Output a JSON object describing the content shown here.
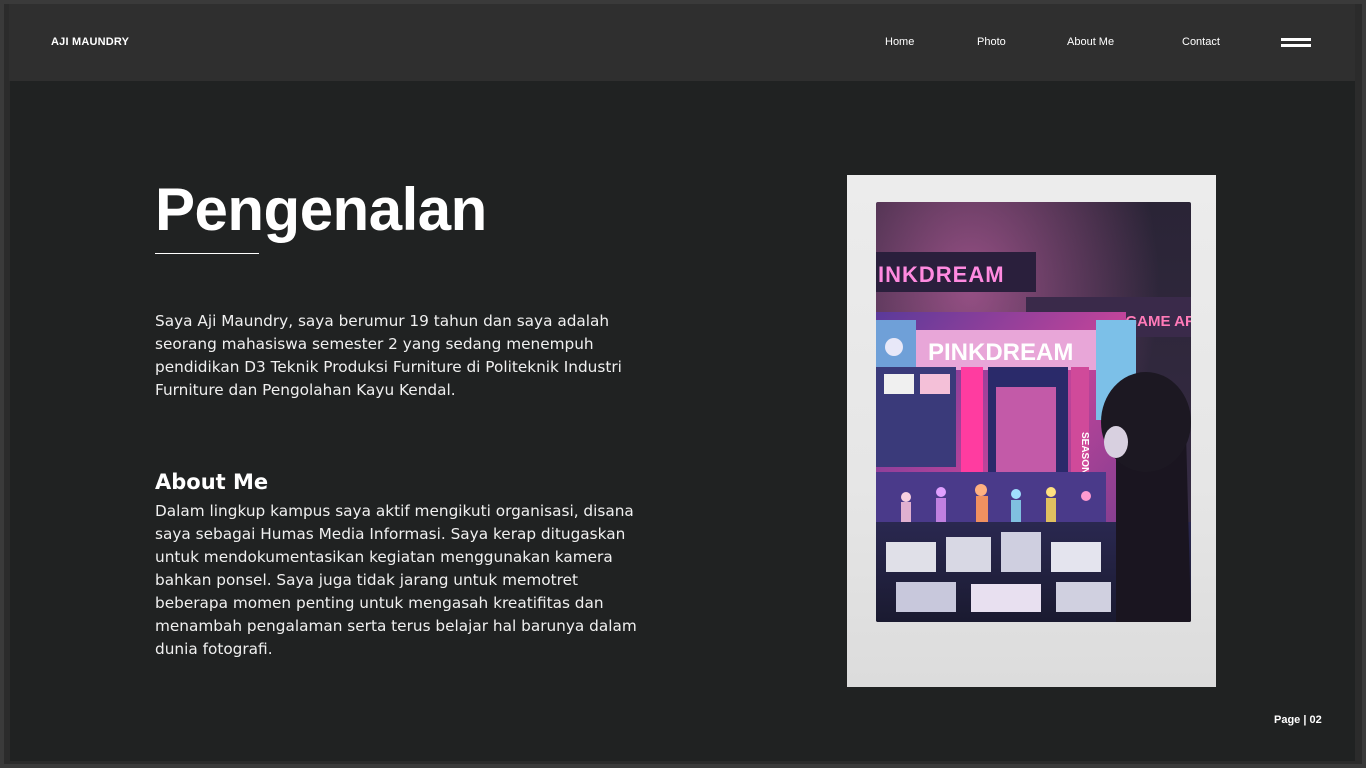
{
  "header": {
    "brand": "AJI MAUNDRY",
    "nav": [
      {
        "label": "Home"
      },
      {
        "label": "Photo"
      },
      {
        "label": "About Me"
      },
      {
        "label": "Contact"
      }
    ],
    "menu_icon": "hamburger-menu-icon"
  },
  "main": {
    "title": "Pengenalan",
    "intro": "Saya Aji Maundry, saya berumur 19 tahun dan saya adalah seorang mahasiswa semester 2 yang sedang menempuh pendidikan D3 Teknik Produksi Furniture di Politeknik Industri Furniture dan Pengolahan Kayu Kendal.",
    "about_heading": "About Me",
    "about_text": "Dalam lingkup kampus saya aktif mengikuti organisasi, disana saya sebagai Humas Media Informasi. Saya kerap ditugaskan untuk mendokumentasikan kegiatan menggunakan kamera bahkan ponsel. Saya juga tidak jarang untuk memotret beberapa momen penting  untuk mengasah kreatifitas dan menambah pengalaman serta terus belajar hal barunya dalam dunia fotografi."
  },
  "photo": {
    "sign_top": "INKDREAM",
    "sign_main": "PINKDREAM",
    "sign_right": "SEASON GAME AR",
    "sign_vertical": "SEASON"
  },
  "footer": {
    "page": "Page | 02"
  },
  "colors": {
    "background": "#202222",
    "header": "#2f2f2f",
    "text": "#ffffff",
    "neon_pink": "#ff4fb0"
  }
}
